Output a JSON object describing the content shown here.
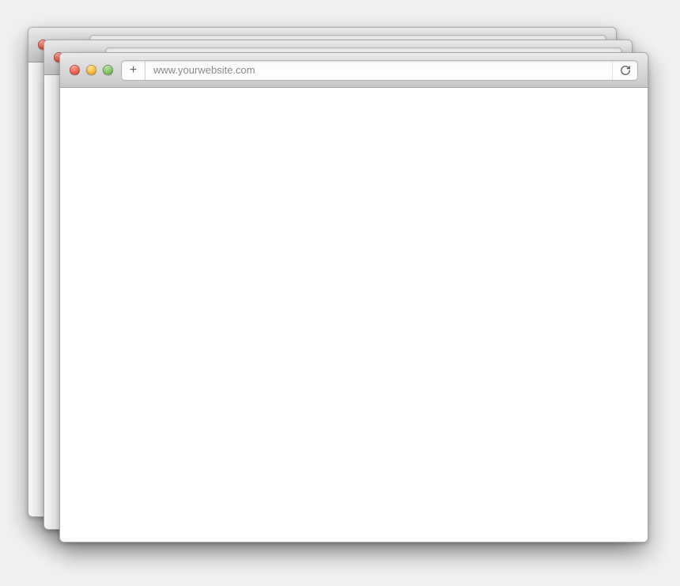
{
  "browser": {
    "address_value": "www.yourwebsite.com",
    "new_tab_label": "+",
    "traffic_lights": {
      "close": "close",
      "minimize": "minimize",
      "zoom": "zoom"
    }
  }
}
